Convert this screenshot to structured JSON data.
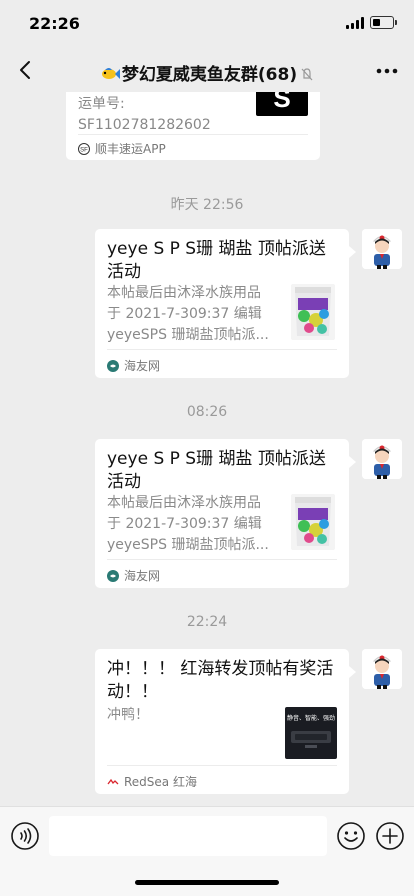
{
  "status_bar": {
    "time": "22:26"
  },
  "nav": {
    "title": "梦幻夏威夷鱼友群(68)"
  },
  "messages": {
    "top_card": {
      "tracking_label": "运单号:",
      "tracking_number": "SF1102781282602",
      "source": "顺丰速运APP",
      "logo_text": "S"
    },
    "time_1": "昨天 22:56",
    "card_1": {
      "title": "yeye S P S珊 瑚盐 顶帖派送活动",
      "desc_line1": "本帖最后由沐泽水族用品",
      "desc_line2": "于 2021-7-309:37 编辑",
      "desc_line3": "yeyeSPS 珊瑚盐顶帖派...",
      "source": "海友网"
    },
    "time_2": "08:26",
    "card_2": {
      "title": "yeye S P S珊 瑚盐 顶帖派送活动",
      "desc_line1": "本帖最后由沐泽水族用品",
      "desc_line2": "于 2021-7-309:37 编辑",
      "desc_line3": "yeyeSPS 珊瑚盐顶帖派...",
      "source": "海友网"
    },
    "time_3": "22:24",
    "card_3": {
      "title": "冲！！！ 红海转发顶帖有奖活动！！",
      "desc": "冲鸭！",
      "source": "RedSea 红海",
      "thumb_caption": "静音、智能、强劲"
    }
  },
  "input": {
    "placeholder": ""
  },
  "icons": [
    "back-icon",
    "fish-icon",
    "mute-icon",
    "more-icon",
    "voice-icon",
    "emoji-icon",
    "plus-icon"
  ],
  "colors": {
    "background": "#ededed",
    "card": "#ffffff",
    "muted_text": "#8a8a8a",
    "sf_black": "#000000"
  }
}
